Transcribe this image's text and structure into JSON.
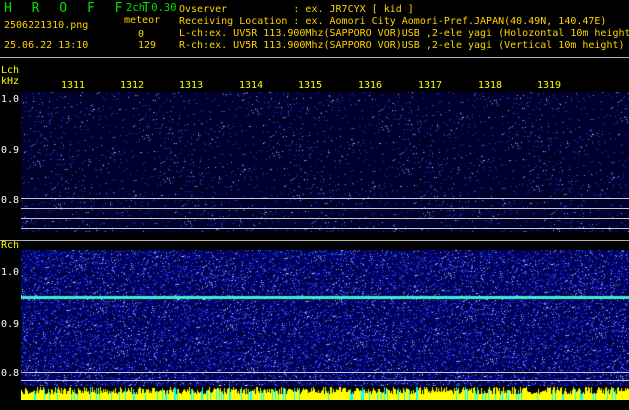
{
  "header": {
    "app_title": "H R O F F T",
    "channel_info": "2ch 0.30",
    "filename": "2506221310.png",
    "meteor_label": "meteor",
    "meteor_lch": "0",
    "meteor_rch": "129",
    "datetime": "25.06.22 13:10",
    "observer_line": "Ovserver           : ex. JR7CYX [ kid ]",
    "location_line": "Receiving Location : ex. Aomori City Aomori-Pref.JAPAN(40.49N, 140.47E)",
    "lch_line": "L-ch:ex. UV5R 113.900Mhz(SAPPORO VOR)USB ,2-ele yagi (Holozontal 10m height",
    "rch_line": "R-ch:ex. UV5R 113.900Mhz(SAPPORO VOR)USB ,2-ele yagi (Vertical 10m height)"
  },
  "axis": {
    "lch_label": "Lch",
    "unit_label": "kHz",
    "rch_label": "Rch",
    "time_ticks": [
      "1311",
      "1312",
      "1313",
      "1314",
      "1315",
      "1316",
      "1317",
      "1318",
      "1319"
    ],
    "lch_freq_ticks": [
      "1.0",
      "0.9",
      "0.8"
    ],
    "rch_freq_ticks": [
      "1.0",
      "0.9",
      "0.8"
    ]
  },
  "colors": {
    "background": "#000000",
    "text_green": "#00e000",
    "text_yellow": "#ffd400",
    "waterfall_dark": "#000070",
    "waterfall_mid": "#1030d0",
    "carrier_line": "#40ffc0",
    "meteor_bar_yellow": "#ffff00",
    "meteor_bar_cyan": "#00ffff"
  }
}
